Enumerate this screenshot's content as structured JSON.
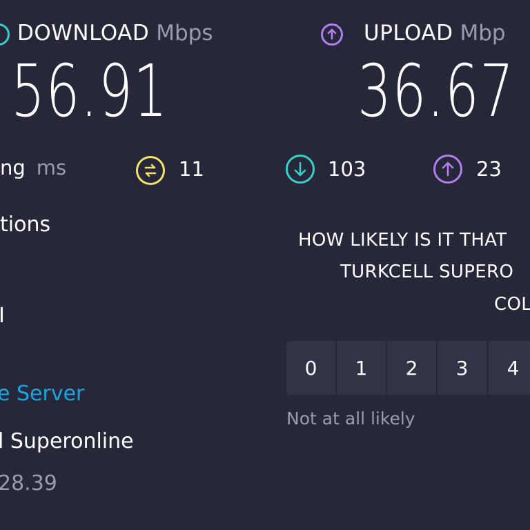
{
  "download": {
    "label": "DOWNLOAD",
    "unit": "Mbps",
    "value": "56.91",
    "color": "#35d0c8"
  },
  "upload": {
    "label": "UPLOAD",
    "unit": "Mbp",
    "value": "36.67",
    "color": "#b57ef0"
  },
  "ping": {
    "label": "ng",
    "unit": "ms",
    "jitter_value": "11",
    "jitter_color": "#f2e26a",
    "download_latency": "103",
    "upload_latency": "23"
  },
  "connections": {
    "label": "tions",
    "value_partial": "I"
  },
  "server": {
    "change_label": "e Server",
    "name": "l Superonline",
    "location_partial": "28.39"
  },
  "survey": {
    "line1": "HOW LIKELY IS IT THAT",
    "line2": "TURKCELL SUPERO",
    "line3": "COL",
    "scale": [
      "0",
      "1",
      "2",
      "3",
      "4"
    ],
    "low_label": "Not at all likely"
  }
}
